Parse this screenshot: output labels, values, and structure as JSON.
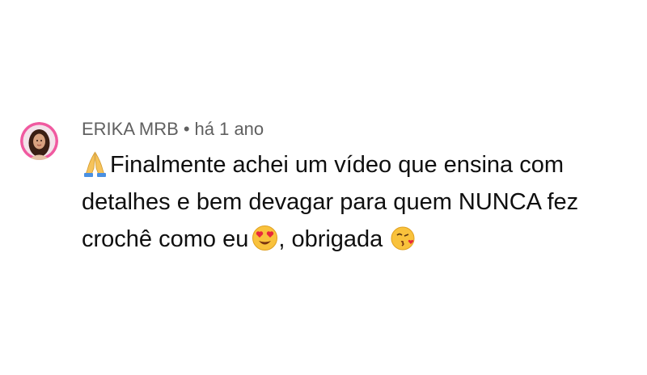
{
  "comment": {
    "author": "ERIKA MRB",
    "separator": "•",
    "timestamp": "há 1 ano",
    "avatar_icon": "profile-photo-avatar",
    "text_part1": "Finalmente achei um vídeo que ensina com detalhes e bem devagar para quem NUNCA fez crochê como eu",
    "text_part2": ", obrigada",
    "emojis": {
      "lead": "folded-hands-emoji",
      "mid": "heart-eyes-emoji",
      "end": "face-blowing-kiss-emoji"
    }
  },
  "colors": {
    "meta_text": "#606060",
    "body_text": "#0f0f0f",
    "avatar_ring": "#f05aa0"
  }
}
